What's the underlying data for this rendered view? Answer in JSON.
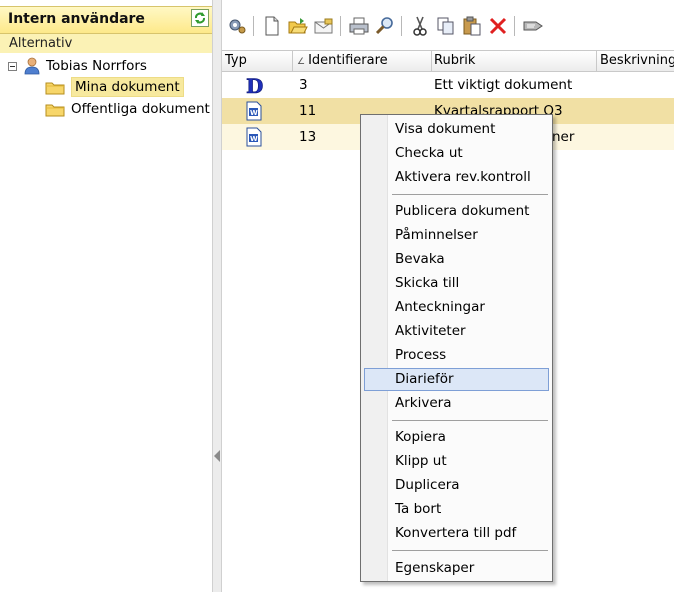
{
  "left_panel": {
    "title": "Intern användare",
    "options_label": "Alternativ",
    "tree": {
      "root": "Tobias Norrfors",
      "children": [
        "Mina dokument",
        "Offentliga dokument"
      ]
    }
  },
  "toolbar": {
    "icons": [
      "settings-icon",
      "new-document-icon",
      "open-folder-icon",
      "email-icon",
      "print-icon",
      "search-icon",
      "cut-icon",
      "copy-icon",
      "paste-icon",
      "delete-icon",
      "export-icon"
    ]
  },
  "list": {
    "columns": [
      "Typ",
      "Identifierare",
      "Rubrik",
      "Beskrivning"
    ],
    "rows": [
      {
        "type_icon": "d-document-icon",
        "id": "3",
        "title": "Ett viktigt dokument"
      },
      {
        "type_icon": "word-document-icon",
        "id": "11",
        "title": "Kvartalsrapport Q3"
      },
      {
        "type_icon": "word-document-icon",
        "id": "13",
        "title": "ner"
      }
    ]
  },
  "context_menu": {
    "groups": [
      [
        "Visa dokument",
        "Checka ut",
        "Aktivera rev.kontroll"
      ],
      [
        "Publicera dokument",
        "Påminnelser",
        "Bevaka",
        "Skicka till",
        "Anteckningar",
        "Aktiviteter",
        "Process",
        "Diarieför",
        "Arkivera"
      ],
      [
        "Kopiera",
        "Klipp ut",
        "Duplicera",
        "Ta bort",
        "Konvertera till pdf"
      ],
      [
        "Egenskaper"
      ]
    ],
    "highlighted": "Diarieför"
  },
  "colors": {
    "header_yellow": "#fde98a",
    "selection_blue": "#dce7f7",
    "delete_red": "#e02020"
  }
}
